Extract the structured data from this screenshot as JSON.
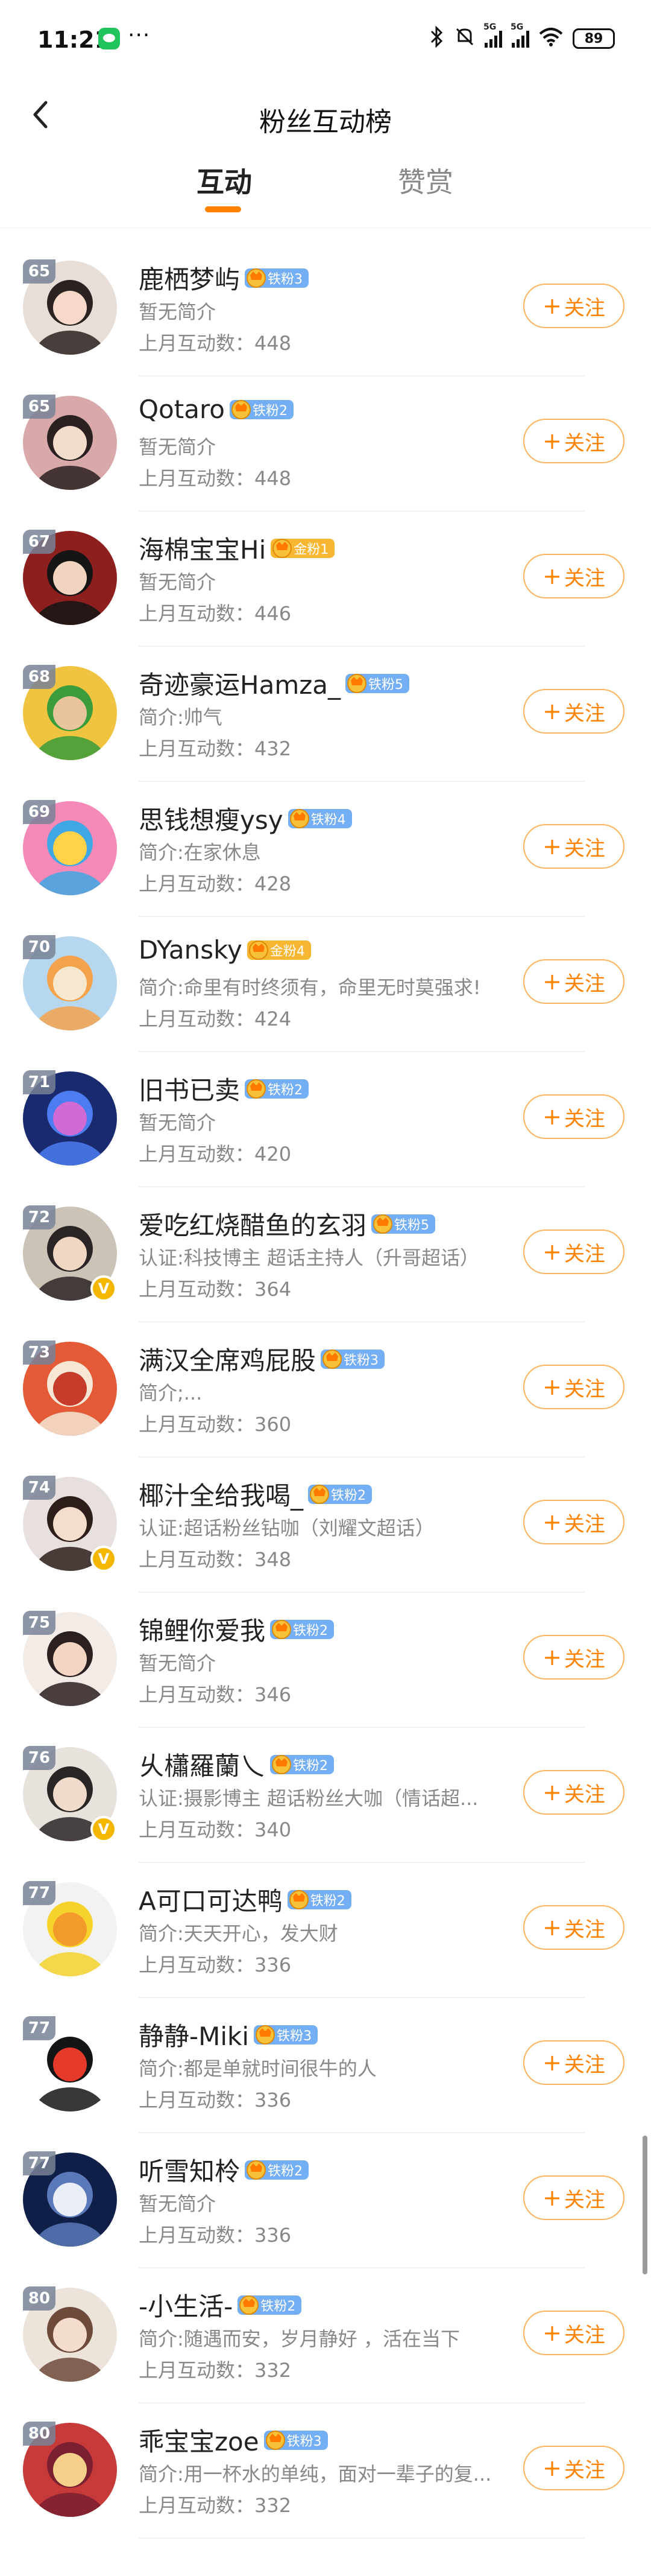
{
  "status_bar": {
    "time": "11:21",
    "dots": "···",
    "battery": "89"
  },
  "header": {
    "title": "粉丝互动榜"
  },
  "tabs": [
    {
      "label": "互动"
    },
    {
      "label": "赞赏"
    }
  ],
  "colors": {
    "accent": "#ff8200",
    "iron_badge": "#74aef4",
    "gold_badge": "#f8b732"
  },
  "list": {
    "follow_label": "关注",
    "items": [
      {
        "rank": "65",
        "name": "鹿栖梦屿",
        "badge": "铁粉3",
        "badge_type": "iron",
        "desc": "暂无简介",
        "count": "上月互动数：448",
        "verified": false
      },
      {
        "rank": "65",
        "name": "Qotaro",
        "badge": "铁粉2",
        "badge_type": "iron",
        "desc": "暂无简介",
        "count": "上月互动数：448",
        "verified": false
      },
      {
        "rank": "67",
        "name": "海棉宝宝Hi",
        "badge": "金粉1",
        "badge_type": "gold",
        "desc": "暂无简介",
        "count": "上月互动数：446",
        "verified": false
      },
      {
        "rank": "68",
        "name": "奇迹豪运Hamza_",
        "badge": "铁粉5",
        "badge_type": "iron",
        "desc": "简介:帅气",
        "count": "上月互动数：432",
        "verified": false
      },
      {
        "rank": "69",
        "name": "思钱想瘦ysy",
        "badge": "铁粉4",
        "badge_type": "iron",
        "desc": "简介:在家休息",
        "count": "上月互动数：428",
        "verified": false
      },
      {
        "rank": "70",
        "name": "DYansky",
        "badge": "金粉4",
        "badge_type": "gold",
        "desc": "简介:命里有时终须有，命里无时莫强求!",
        "count": "上月互动数：424",
        "verified": false
      },
      {
        "rank": "71",
        "name": "旧书已卖",
        "badge": "铁粉2",
        "badge_type": "iron",
        "desc": "暂无简介",
        "count": "上月互动数：420",
        "verified": false
      },
      {
        "rank": "72",
        "name": "爱吃红烧醋鱼的玄羽",
        "badge": "铁粉5",
        "badge_type": "iron",
        "desc": "认证:科技博主 超话主持人（升哥超话）",
        "count": "上月互动数：364",
        "verified": true
      },
      {
        "rank": "73",
        "name": "满汉全席鸡屁股",
        "badge": "铁粉3",
        "badge_type": "iron",
        "desc": "简介;...",
        "count": "上月互动数：360",
        "verified": false
      },
      {
        "rank": "74",
        "name": "椰汁全给我喝_",
        "badge": "铁粉2",
        "badge_type": "iron",
        "desc": "认证:超话粉丝钻咖（刘耀文超话）",
        "count": "上月互动数：348",
        "verified": true
      },
      {
        "rank": "75",
        "name": "锦鲤你爱我",
        "badge": "铁粉2",
        "badge_type": "iron",
        "desc": "暂无简介",
        "count": "上月互动数：346",
        "verified": false
      },
      {
        "rank": "76",
        "name": "乆櫹羅蘭乀",
        "badge": "铁粉2",
        "badge_type": "iron",
        "desc": "认证:摄影博主 超话粉丝大咖（情话超...",
        "count": "上月互动数：340",
        "verified": true
      },
      {
        "rank": "77",
        "name": "A可口可达鸭",
        "badge": "铁粉2",
        "badge_type": "iron",
        "desc": "简介:天天开心，发大财",
        "count": "上月互动数：336",
        "verified": false
      },
      {
        "rank": "77",
        "name": "静静-Miki",
        "badge": "铁粉3",
        "badge_type": "iron",
        "desc": "简介:都是单就时间很牛的人",
        "count": "上月互动数：336",
        "verified": false
      },
      {
        "rank": "77",
        "name": "听雪知柃",
        "badge": "铁粉2",
        "badge_type": "iron",
        "desc": "暂无简介",
        "count": "上月互动数：336",
        "verified": false
      },
      {
        "rank": "80",
        "name": "-小生活-",
        "badge": "铁粉2",
        "badge_type": "iron",
        "desc": "简介:随遇而安，岁月静好 ，活在当下",
        "count": "上月互动数：332",
        "verified": false
      },
      {
        "rank": "80",
        "name": "乖宝宝zoe",
        "badge": "铁粉3",
        "badge_type": "iron",
        "desc": "简介:用一杯水的单纯，面对一辈子的复...",
        "count": "上月互动数：332",
        "verified": false
      }
    ]
  }
}
